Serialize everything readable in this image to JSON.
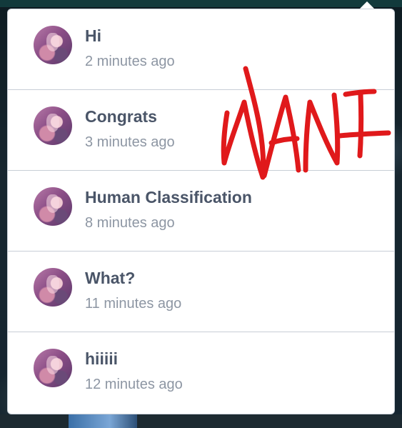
{
  "notifications": [
    {
      "title": "Hi",
      "time": "2 minutes ago"
    },
    {
      "title": "Congrats",
      "time": "3 minutes ago"
    },
    {
      "title": "Human Classification",
      "time": "8 minutes ago"
    },
    {
      "title": "What?",
      "time": "11 minutes ago"
    },
    {
      "title": "hiiiii",
      "time": "12 minutes ago"
    }
  ],
  "annotation": {
    "text": "NANI",
    "color": "#e0191b"
  },
  "colors": {
    "title": "#4a5568",
    "time": "#8d96a3",
    "divider": "#c8ced6",
    "panel": "#ffffff"
  }
}
